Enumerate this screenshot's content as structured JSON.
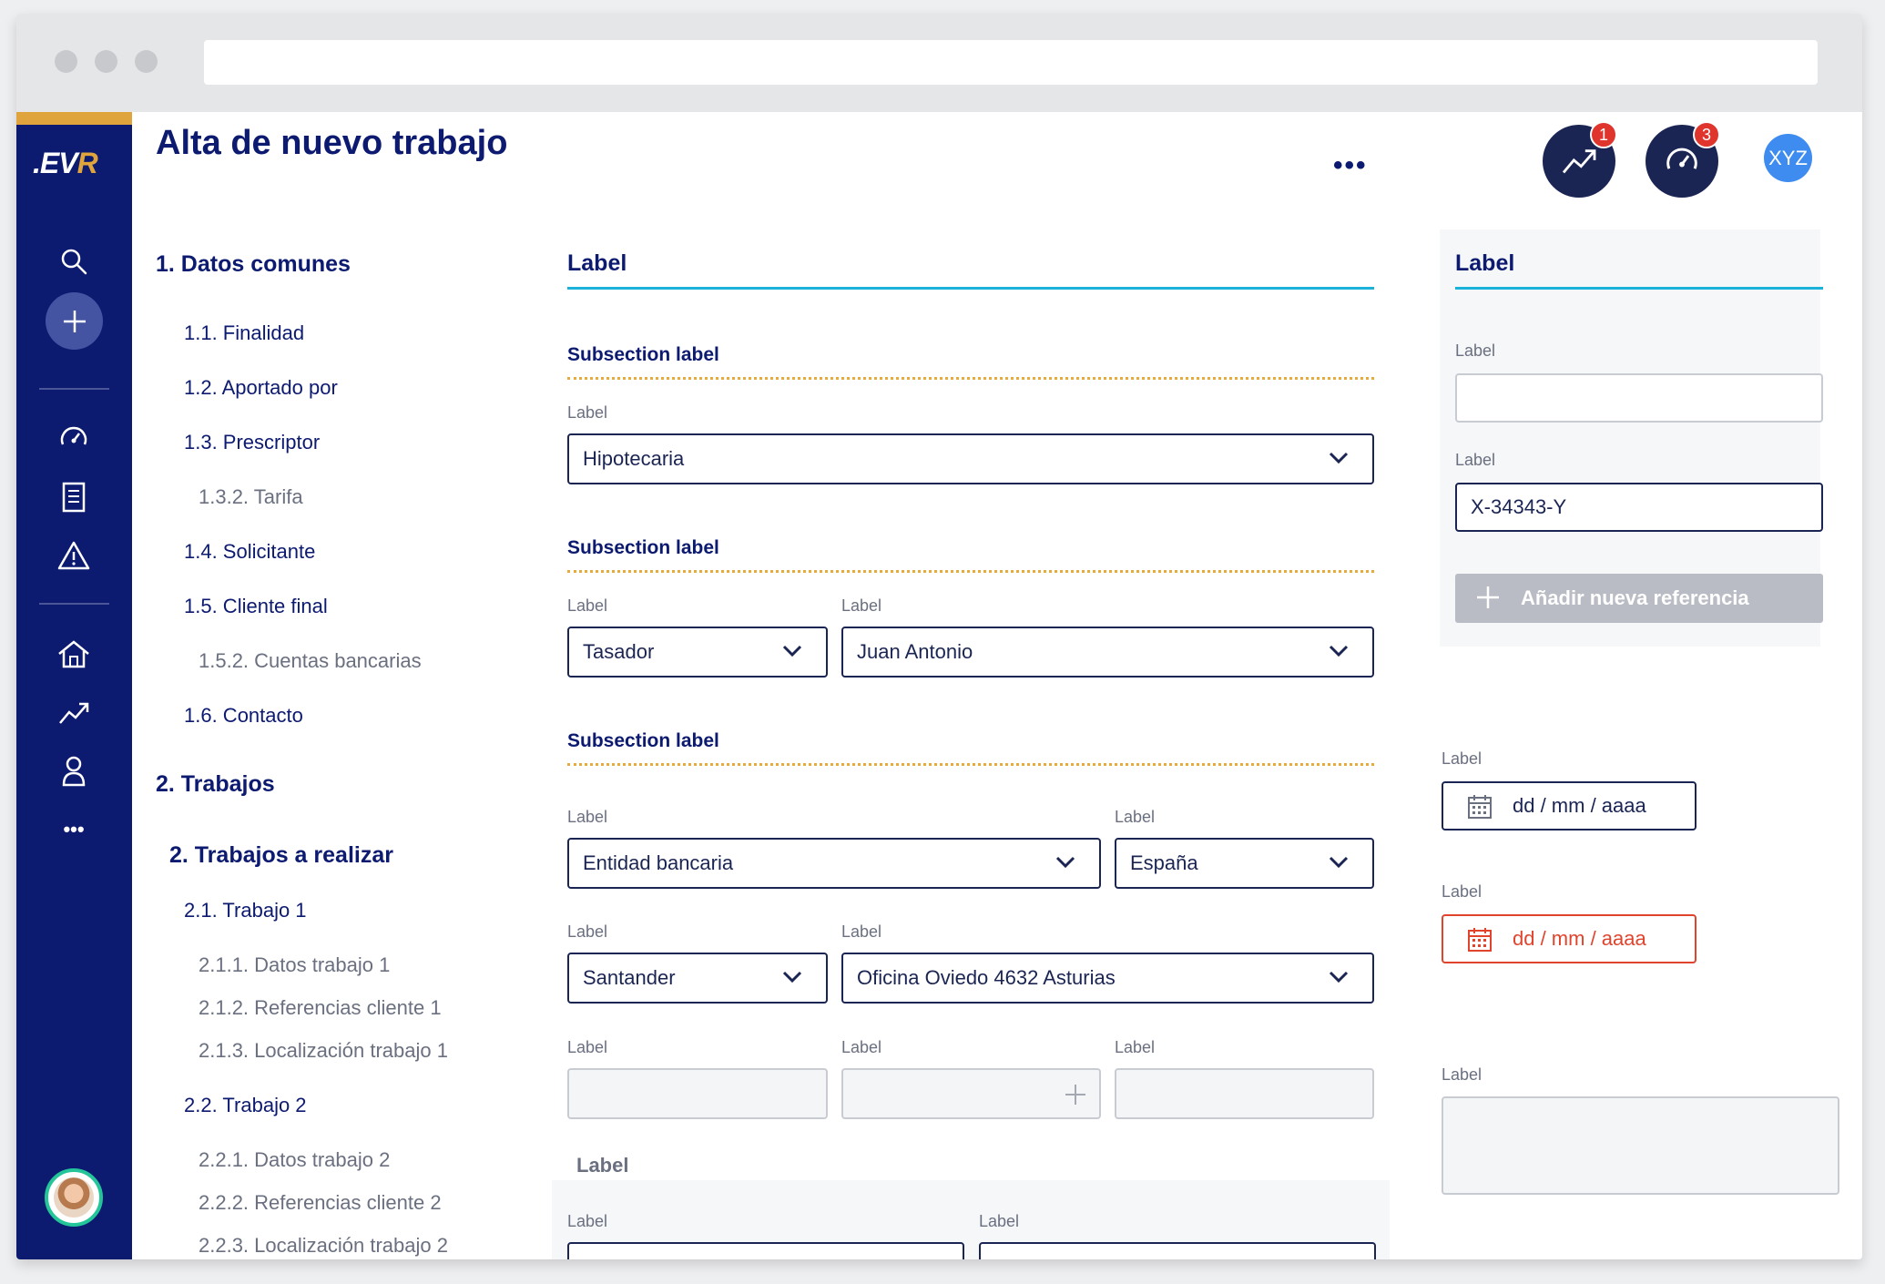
{
  "app": {
    "logo_main": ".EV",
    "logo_accent": "R",
    "page_title": "Alta de nuevo trabajo",
    "more_label": "•••",
    "trend_badge": "1",
    "speed_badge": "3",
    "user_initials": "XYZ"
  },
  "sidebar": {
    "icons": [
      "search-icon",
      "plus-icon",
      "speedometer-icon",
      "document-icon",
      "warning-icon",
      "home-icon",
      "trend-icon",
      "user-icon",
      "more-icon"
    ],
    "more_label": "•••"
  },
  "toc": {
    "items": [
      {
        "label": "1. Datos comunes"
      },
      {
        "label": "1.1. Finalidad"
      },
      {
        "label": "1.2. Aportado por"
      },
      {
        "label": "1.3. Prescriptor"
      },
      {
        "label": "1.3.2. Tarifa"
      },
      {
        "label": "1.4. Solicitante"
      },
      {
        "label": "1.5. Cliente final"
      },
      {
        "label": "1.5.2. Cuentas bancarias"
      },
      {
        "label": "1.6. Contacto"
      },
      {
        "label": "2. Trabajos"
      },
      {
        "label": "2. Trabajos a realizar"
      },
      {
        "label": "2.1. Trabajo 1"
      },
      {
        "label": "2.1.1. Datos trabajo 1"
      },
      {
        "label": "2.1.2. Referencias cliente 1"
      },
      {
        "label": "2.1.3. Localización trabajo 1"
      },
      {
        "label": "2.2. Trabajo 2"
      },
      {
        "label": "2.2.1. Datos trabajo 2"
      },
      {
        "label": "2.2.2. Referencias cliente 2"
      },
      {
        "label": "2.2.3. Localización trabajo 2"
      }
    ]
  },
  "form": {
    "section_label": "Label",
    "subsection1": "Subsection label",
    "subsection2": "Subsection label",
    "subsection3": "Subsection label",
    "label": "Label",
    "select_hipotecaria": "Hipotecaria",
    "select_tasador": "Tasador",
    "select_juan": "Juan Antonio",
    "select_entidad": "Entidad bancaria",
    "select_espana": "España",
    "select_santander": "Santander",
    "select_oficina": "Oficina Oviedo 4632 Asturias",
    "lower_panel_title": "Label"
  },
  "right": {
    "section_label": "Label",
    "label": "Label",
    "reference_value": "X-34343-Y",
    "add_reference": "Añadir nueva referencia",
    "date_placeholder": "dd / mm / aaaa",
    "date_error_placeholder": "dd / mm / aaaa"
  },
  "colors": {
    "navy": "#0c1a70",
    "accent_gold": "#e0a43c",
    "cyan_rule": "#1ab2d8",
    "error_red": "#e0442d"
  }
}
